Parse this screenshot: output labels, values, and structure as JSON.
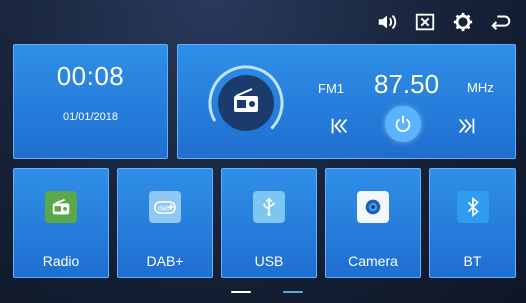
{
  "status_bar": {
    "icons": [
      "volume-icon",
      "close-box-icon",
      "settings-icon",
      "back-icon"
    ]
  },
  "clock": {
    "time": "00:08",
    "date": "01/01/2018"
  },
  "radio": {
    "band": "FM1",
    "frequency": "87.50",
    "unit": "MHz",
    "controls": [
      "previous-icon",
      "power-icon",
      "next-icon"
    ]
  },
  "apps": [
    {
      "label": "Radio",
      "icon": "radio-icon",
      "icon_color": "#5aa84a"
    },
    {
      "label": "DAB+",
      "icon": "dab-icon",
      "icon_color": "#8fc8f5"
    },
    {
      "label": "USB",
      "icon": "usb-icon",
      "icon_color": "#7ec6f2"
    },
    {
      "label": "Camera",
      "icon": "camera-icon",
      "icon_color": "#f3f6fa"
    },
    {
      "label": "BT",
      "icon": "bluetooth-icon",
      "icon_color": "#2f9cf0"
    }
  ],
  "pager": {
    "pages": 2,
    "current": 1
  },
  "colors": {
    "tile": "#2a86e3",
    "tile_border": "#5fb0ff",
    "background": "#172238",
    "power_button": "#5ab4ff"
  }
}
